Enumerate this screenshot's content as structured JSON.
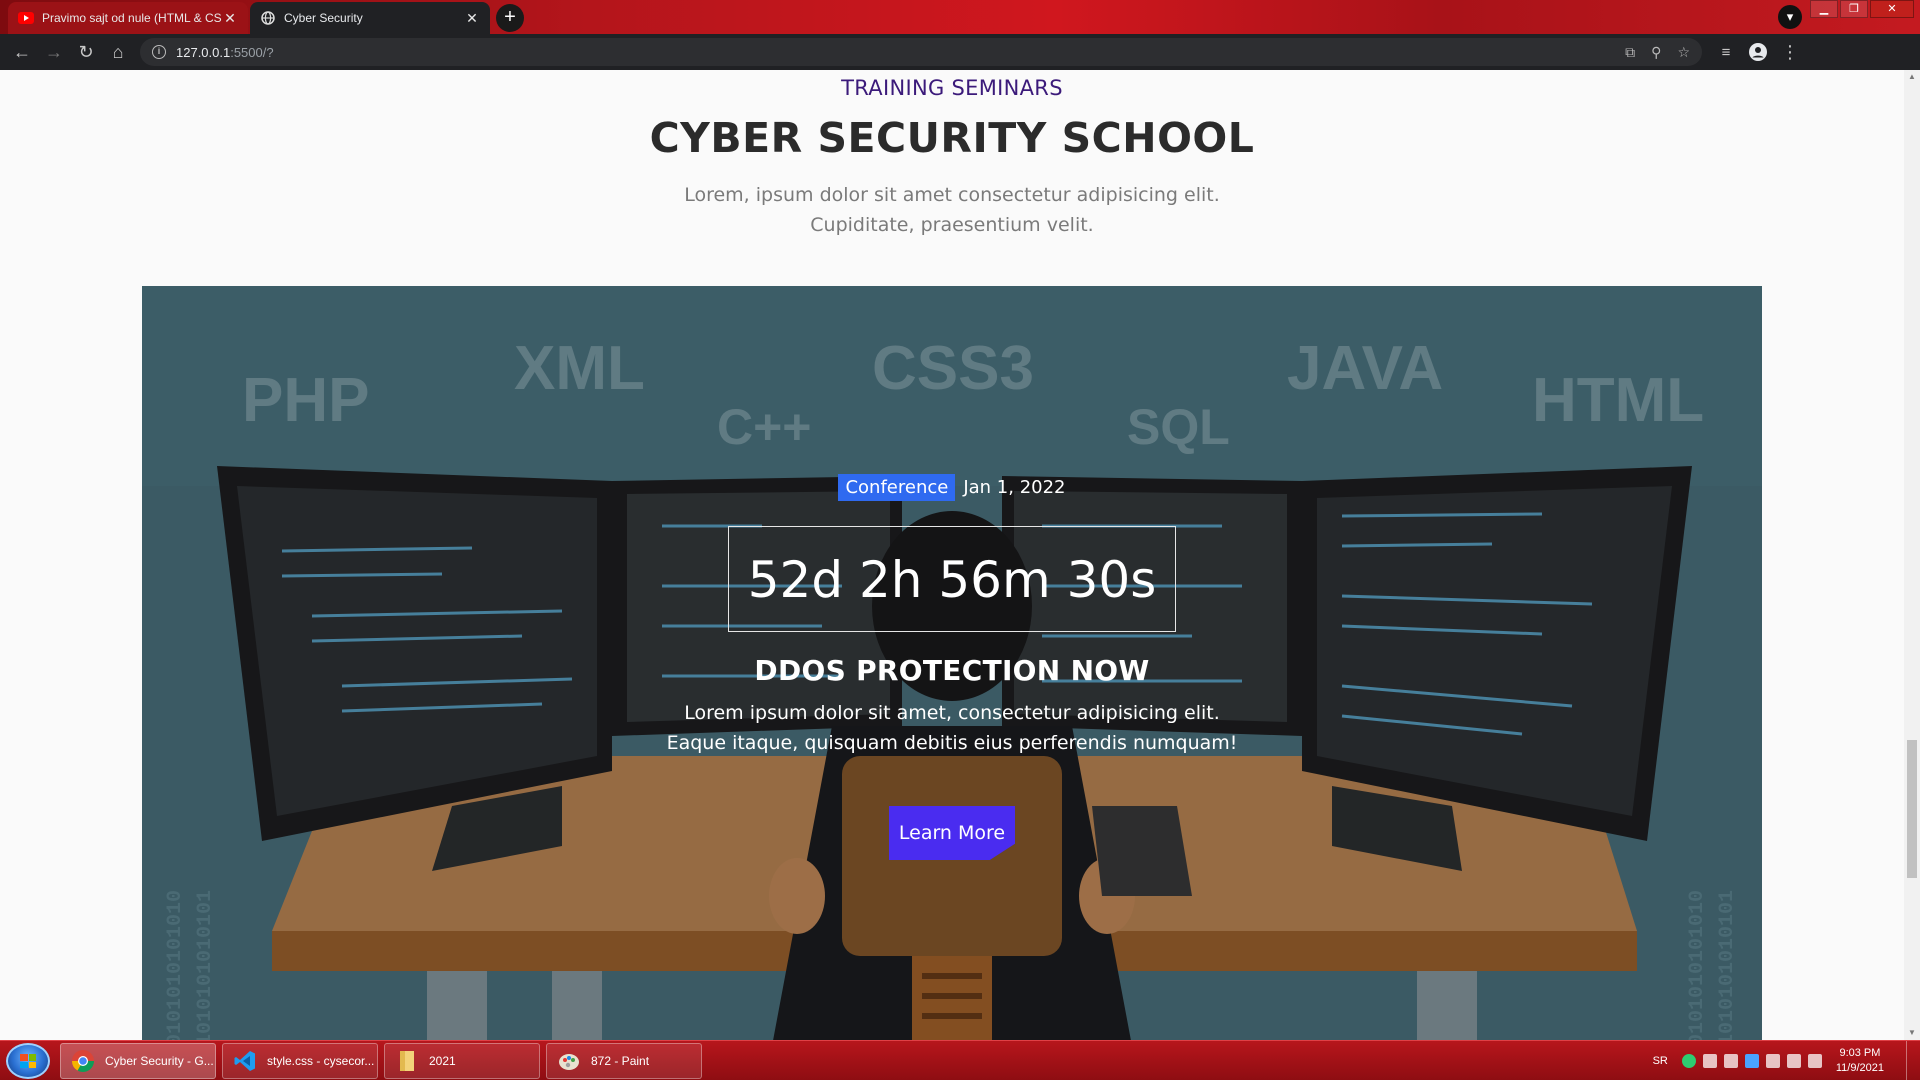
{
  "browser": {
    "tabs": [
      {
        "title": "Pravimo sajt od nule (HTML & CSS)",
        "active": false,
        "favicon": "youtube-icon"
      },
      {
        "title": "Cyber Security",
        "active": true,
        "favicon": "globe-icon"
      }
    ],
    "new_tab_label": "+",
    "address": {
      "host": "127.0.0.1",
      "path": ":5500/?"
    }
  },
  "page": {
    "eyebrow": "TRAINING SEMINARS",
    "heading": "CYBER SECURITY SCHOOL",
    "subtext_line1": "Lorem, ipsum dolor sit amet consectetur adipisicing elit.",
    "subtext_line2": "Cupiditate, praesentium velit.",
    "hero": {
      "badge": "Conference",
      "date": "Jan 1, 2022",
      "countdown": "52d 2h 56m 30s",
      "title": "DDOS PROTECTION NOW",
      "text_line1": "Lorem ipsum dolor sit amet, consectetur adipisicing elit.",
      "text_line2": "Eaque itaque, quisquam debitis eius perferendis numquam!",
      "button_label": "Learn More",
      "bg_words": [
        "PHP",
        "XML",
        "C++",
        "CSS3",
        "SQL",
        "JAVA",
        "HTML"
      ],
      "accent_color": "#2f6af0",
      "button_color": "#4a2cf0"
    }
  },
  "taskbar": {
    "items": [
      {
        "label": "Cyber Security - G...",
        "icon": "chrome-icon",
        "active": true
      },
      {
        "label": "style.css - cysecor...",
        "icon": "vscode-icon",
        "active": false
      },
      {
        "label": "2021",
        "icon": "folder-icon",
        "active": false
      },
      {
        "label": "872 - Paint",
        "icon": "paint-icon",
        "active": false
      }
    ],
    "lang": "SR",
    "time": "9:03 PM",
    "date": "11/9/2021"
  }
}
